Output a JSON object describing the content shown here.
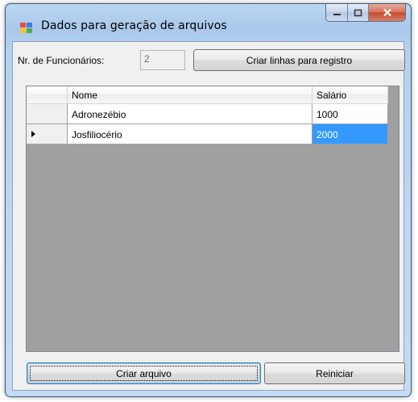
{
  "window": {
    "title": "Dados para geração de arquivos"
  },
  "caption_buttons": {
    "minimize": "minimize-icon",
    "maximize": "maximize-icon",
    "close": "close-icon"
  },
  "form": {
    "func_label": "Nr. de Funcionários:",
    "func_value": "2",
    "create_rows_button": "Criar linhas para registro",
    "create_file_button": "Criar arquivo",
    "reset_button": "Reiniciar"
  },
  "grid": {
    "columns": [
      "Nome",
      "Salário"
    ],
    "rows": [
      {
        "nome": "Adronezébio",
        "salario": "1000"
      },
      {
        "nome": "Josfiliocério",
        "salario": "2000"
      }
    ],
    "current_row": 1
  },
  "colors": {
    "selection": "#3399ff",
    "grid_background": "#a0a0a0",
    "window_frame": "#b6d1ef"
  }
}
